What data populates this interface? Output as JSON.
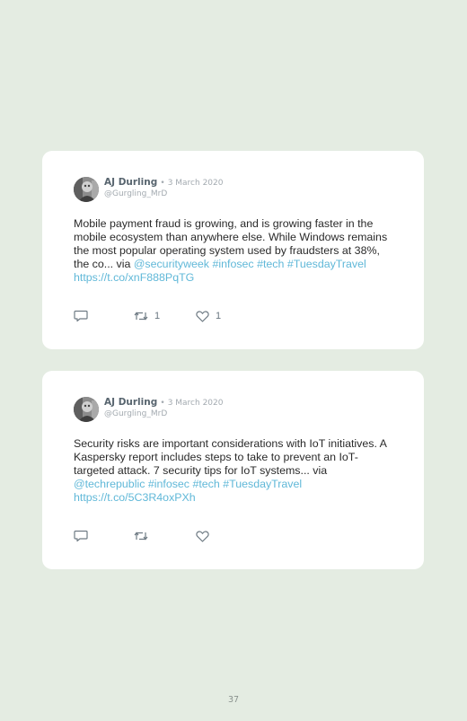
{
  "tweets": [
    {
      "author_name": "AJ Durling",
      "separator": "•",
      "date": "3 March 2020",
      "handle": "@Gurgling_MrD",
      "text": "Mobile payment fraud is growing, and is growing faster in the mobile ecosystem than anywhere else. While Windows remains the most popular operating system used by fraudsters at 38%, the co... via ",
      "links": [
        "@securityweek",
        "#infosec",
        "#tech",
        "#TuesdayTravel",
        "https://t.co/xnF888PqTG"
      ],
      "retweet_count": "1",
      "like_count": "1"
    },
    {
      "author_name": "AJ Durling",
      "separator": "•",
      "date": "3 March 2020",
      "handle": "@Gurgling_MrD",
      "text": "Security risks are important considerations with IoT initiatives. A Kaspersky report includes steps to take to prevent an IoT-targeted attack. 7 security tips for IoT systems... via ",
      "links": [
        "@techrepublic",
        "#infosec",
        "#tech",
        "#TuesdayTravel",
        "https://t.co/5C3R4oxPXh"
      ],
      "retweet_count": "",
      "like_count": ""
    }
  ],
  "icons": {
    "reply": "reply-icon",
    "retweet": "retweet-icon",
    "like": "heart-icon",
    "avatar": "avatar"
  },
  "colors": {
    "background": "#e4ece2",
    "card": "#ffffff",
    "link": "#60b8d8",
    "name": "#58656f",
    "meta": "#a3aab0"
  },
  "page_number": "37"
}
